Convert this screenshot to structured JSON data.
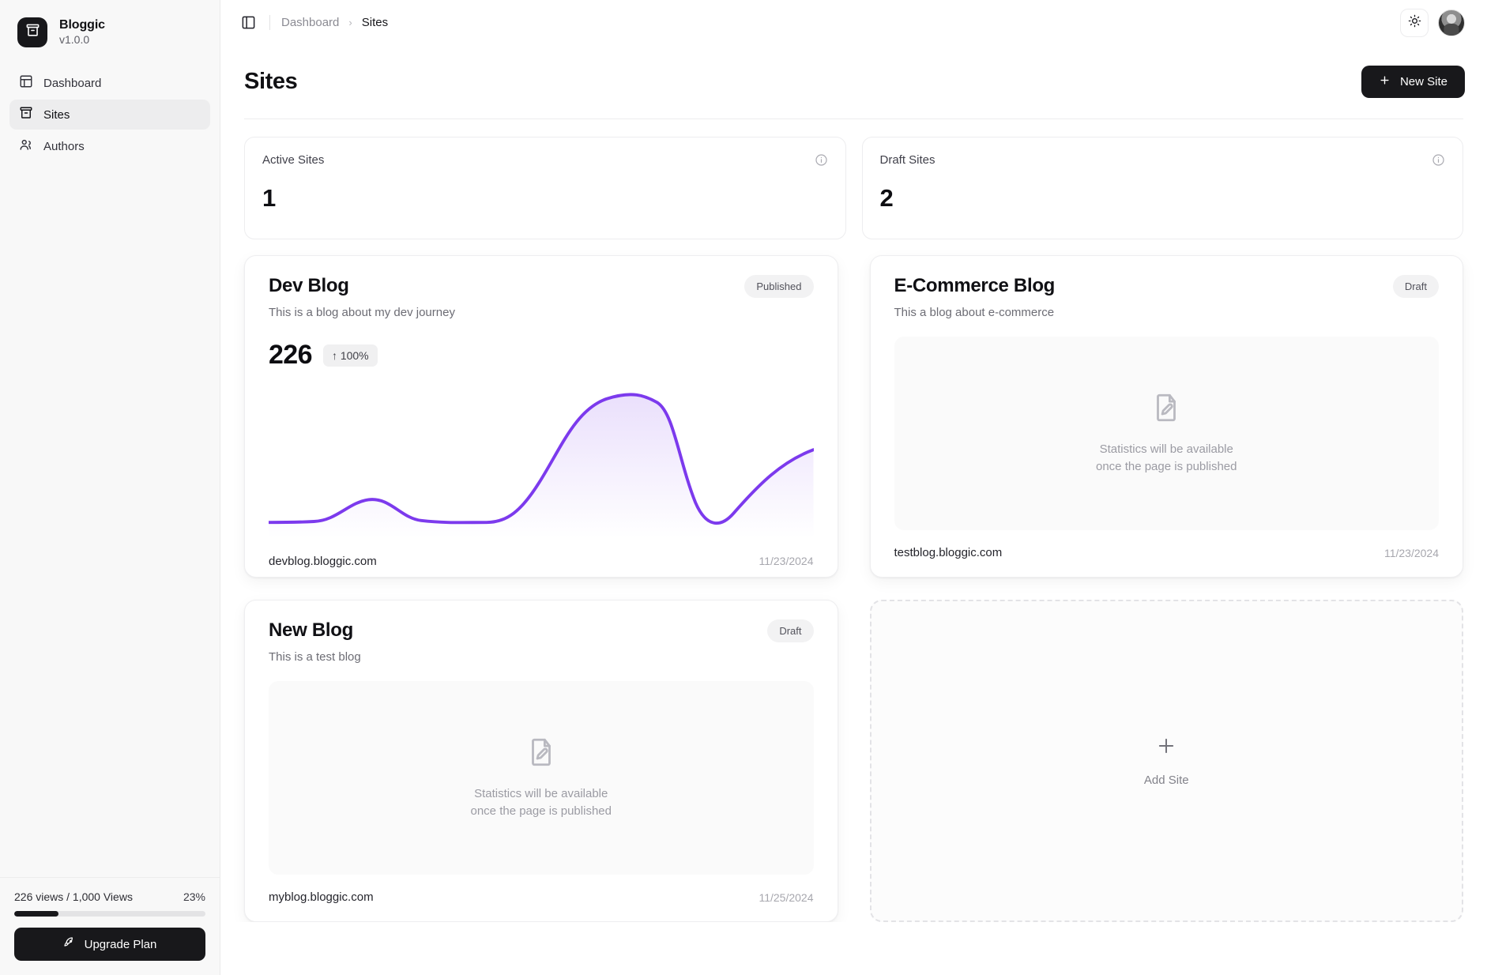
{
  "brand": {
    "name": "Bloggic",
    "version": "v1.0.0",
    "logo_icon": "archive-box-icon"
  },
  "sidebar": {
    "items": [
      {
        "label": "Dashboard",
        "icon": "layout-dashboard-icon",
        "active": false
      },
      {
        "label": "Sites",
        "icon": "archive-box-icon",
        "active": true
      },
      {
        "label": "Authors",
        "icon": "users-icon",
        "active": false
      }
    ],
    "usage": {
      "text": "226 views / 1,000 Views",
      "percent_label": "23%",
      "percent_value": 23,
      "bar_color": "#18181b"
    },
    "upgrade_button": {
      "label": "Upgrade Plan",
      "icon": "rocket-icon"
    }
  },
  "topbar": {
    "panel_toggle_icon": "panel-left-icon",
    "breadcrumb": {
      "parent": "Dashboard",
      "separator": "›",
      "current": "Sites"
    },
    "theme_toggle_icon": "sun-icon",
    "avatar_icon": "user-avatar"
  },
  "page": {
    "title": "Sites",
    "new_site_button": {
      "label": "New Site",
      "icon": "plus-icon"
    }
  },
  "stats": [
    {
      "label": "Active Sites",
      "value": "1",
      "info_icon": "info-circle-icon"
    },
    {
      "label": "Draft Sites",
      "value": "2",
      "info_icon": "info-circle-icon"
    }
  ],
  "sites": [
    {
      "title": "Dev Blog",
      "description": "This is a blog about my dev journey",
      "status": "Published",
      "metric_value": "226",
      "metric_delta": "↑ 100%",
      "domain": "devblog.bloggic.com",
      "date": "11/23/2024",
      "has_chart": true
    },
    {
      "title": "E-Commerce Blog",
      "description": "This a blog about e-commerce",
      "status": "Draft",
      "placeholder_line1": "Statistics will be available",
      "placeholder_line2": "once the page is published",
      "placeholder_icon": "file-edit-icon",
      "domain": "testblog.bloggic.com",
      "date": "11/23/2024",
      "has_chart": false
    },
    {
      "title": "New Blog",
      "description": "This is a test blog",
      "status": "Draft",
      "placeholder_line1": "Statistics will be available",
      "placeholder_line2": "once the page is published",
      "placeholder_icon": "file-edit-icon",
      "domain": "myblog.bloggic.com",
      "date": "11/25/2024",
      "has_chart": false
    }
  ],
  "add_site": {
    "label": "Add Site",
    "icon": "plus-icon"
  },
  "colors": {
    "accent": "#7c3aed",
    "foreground": "#18181b",
    "muted": "#8b8b93",
    "card_border": "#eeeef0",
    "sidebar_bg": "#f8f8f8"
  },
  "chart_data": {
    "type": "line",
    "title": "Dev Blog views sparkline",
    "xlabel": "",
    "ylabel": "views",
    "x": [
      0,
      1,
      2,
      3,
      4,
      5,
      6,
      7,
      8,
      9,
      10,
      11
    ],
    "values": [
      6,
      6,
      8,
      20,
      10,
      7,
      7,
      12,
      55,
      88,
      90,
      20,
      48
    ],
    "ylim": [
      0,
      100
    ],
    "grid": false,
    "legend": "none",
    "line_color": "#7c3aed",
    "fill": "gradient-to-transparent"
  }
}
